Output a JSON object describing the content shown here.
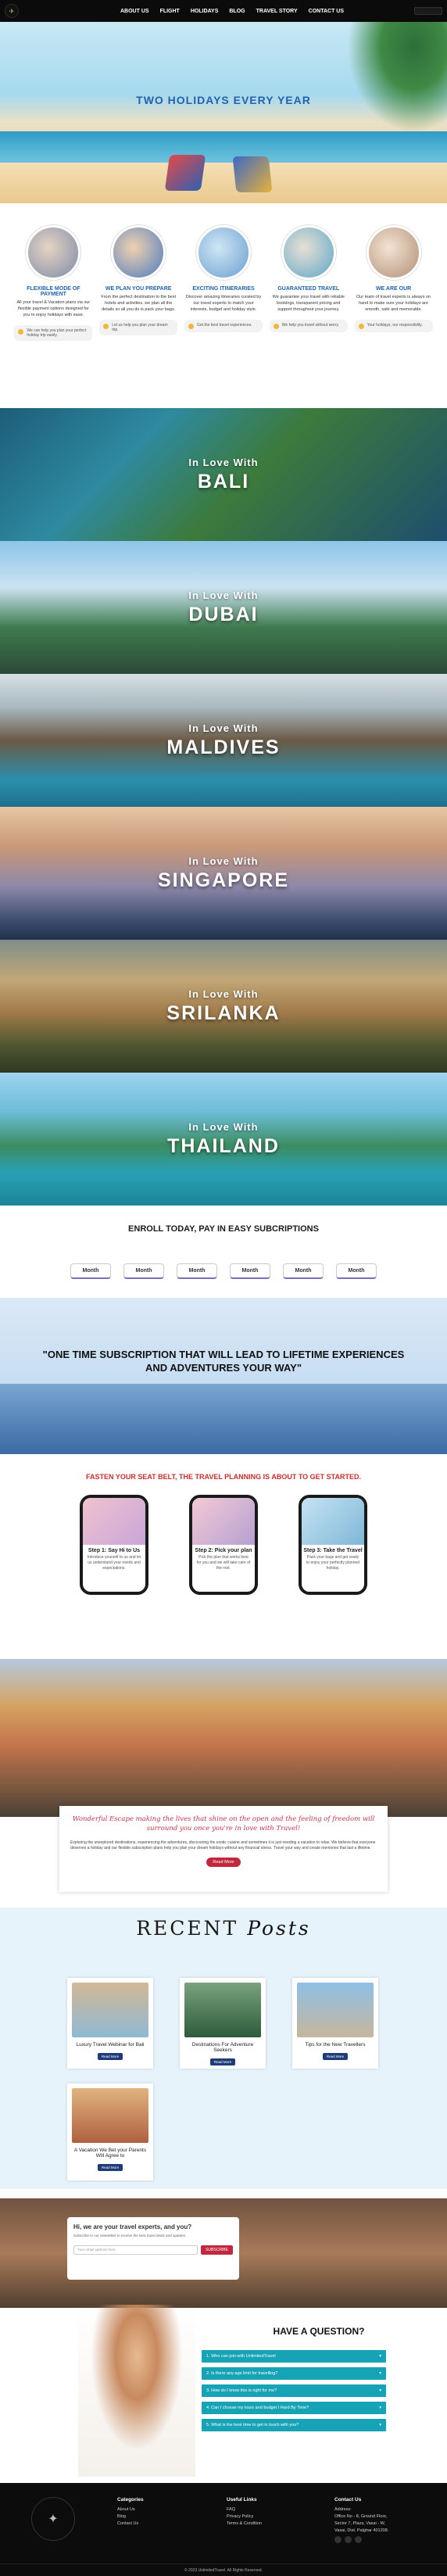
{
  "nav": {
    "items": [
      "ABOUT US",
      "FLIGHT",
      "HOLIDAYS",
      "BLOG",
      "TRAVEL STORY",
      "CONTACT US"
    ]
  },
  "hero": {
    "title": "TWO HOLIDAYS EVERY YEAR"
  },
  "features": [
    {
      "title": "FLEXIBLE MODE OF PAYMENT",
      "text": "All your travel & Vacation plans via our flexible payment options designed for you to enjoy holidays with ease.",
      "note": "We can help you plan your perfect holiday trip easily."
    },
    {
      "title": "WE PLAN YOU PREPARE",
      "text": "From the perfect destination to the best hotels and activities, we plan all the details so all you do is pack your bags.",
      "note": "Let us help you plan your dream trip."
    },
    {
      "title": "EXCITING ITINERARIES",
      "text": "Discover amazing itineraries curated by our travel experts to match your interests, budget and holiday style.",
      "note": "Get the best travel experiences."
    },
    {
      "title": "GUARANTEED TRAVEL",
      "text": "We guarantee your travel with reliable bookings, transparent pricing and support throughout your journey.",
      "note": "We help you travel without worry."
    },
    {
      "title": "WE ARE OUR",
      "text": "Our team of travel experts is always on hand to make sure your holidays are smooth, safe and memorable.",
      "note": "Your holidays, our responsibility."
    }
  ],
  "destinations": [
    {
      "line1": "In Love With",
      "line2": "BALI"
    },
    {
      "line1": "In Love With",
      "line2": "DUBAI"
    },
    {
      "line1": "In Love With",
      "line2": "MALDIVES"
    },
    {
      "line1": "In Love With",
      "line2": "SINGAPORE"
    },
    {
      "line1": "In Love With",
      "line2": "SRILANKA"
    },
    {
      "line1": "In Love With",
      "line2": "THAILAND"
    }
  ],
  "enroll": {
    "title": "ENROLL TODAY, PAY IN EASY SUBCRIPTIONS",
    "months": [
      "Month",
      "Month",
      "Month",
      "Month",
      "Month",
      "Month"
    ]
  },
  "quote": "\"ONE TIME SUBSCRIPTION THAT WILL LEAD TO LIFETIME EXPERIENCES AND ADVENTURES YOUR WAY\"",
  "planning": {
    "headline": "FASTEN YOUR SEAT BELT, THE TRAVEL PLANNING IS ABOUT TO GET STARTED.",
    "steps": [
      {
        "title": "Step 1: Say Hi to Us",
        "text": "Introduce yourself to us and let us understand your needs and expectations."
      },
      {
        "title": "Step 2: Pick your plan",
        "text": "Pick the plan that works best for you and we will take care of the rest."
      },
      {
        "title": "Step 3: Take the Travel",
        "text": "Pack your bags and get ready to enjoy your perfectly planned holiday."
      }
    ]
  },
  "story": {
    "script": "Wonderful Escape making the lives that shine on the open and the feeling of freedom will surround you once you're in love with Travel!",
    "body": "Exploring the unexplored destinations, experiencing the adventures, discovering the exotic cuisine and sometimes it is just needing a vacation to relax. We believe that everyone deserves a holiday and our flexible subscription plans help you plan your dream holidays without any financial stress. Travel your way and create memories that last a lifetime.",
    "button": "Read More"
  },
  "recent": {
    "title_plain": "RECENT",
    "title_script": "Posts",
    "posts": [
      {
        "title": "Luxury Travel Webinar for Bali",
        "button": "Read More"
      },
      {
        "title": "Destinations For Adventure Seekers",
        "button": "Read More"
      },
      {
        "title": "Tips for the New Travellers",
        "button": "Read More"
      },
      {
        "title": "A Vacation We Bet your Parents Will Agree to",
        "button": "Read More"
      }
    ]
  },
  "subscribe": {
    "title": "Hi, we are your travel experts, and you?",
    "text": "Subscribe to our newsletter to receive the best travel deals and updates.",
    "placeholder": "Your email address here",
    "button": "SUBSCRIBE"
  },
  "faq": {
    "title": "HAVE A QUESTION?",
    "items": [
      "1. Who can join with UnlimitedTravel",
      "2. Is there any age limit for travelling?",
      "3. How do I know this is right for me?",
      "4. Can I choose my tours and budget I Hard By Time?",
      "5. What is the best time to get in touch with you?"
    ]
  },
  "footer": {
    "categories_title": "Categories",
    "categories": [
      "About Us",
      "Blog",
      "Contact Us"
    ],
    "links_title": "Useful Links",
    "links": [
      "FAQ",
      "Privacy Policy",
      "Terms & Condition"
    ],
    "contact_title": "Contact Us",
    "contact": [
      "Address:",
      "Office No - 8, Ground Floor,",
      "Sector 7, Plaza, Vasai - W,",
      "Vasai, Dist. Palghar 401208."
    ],
    "copyright": "© 2023 UnlimitedTravel. All Rights Reserved."
  },
  "colors": {
    "accent_blue": "#1f63b0",
    "accent_red": "#c1273e",
    "faq_teal": "#17a3b6"
  }
}
